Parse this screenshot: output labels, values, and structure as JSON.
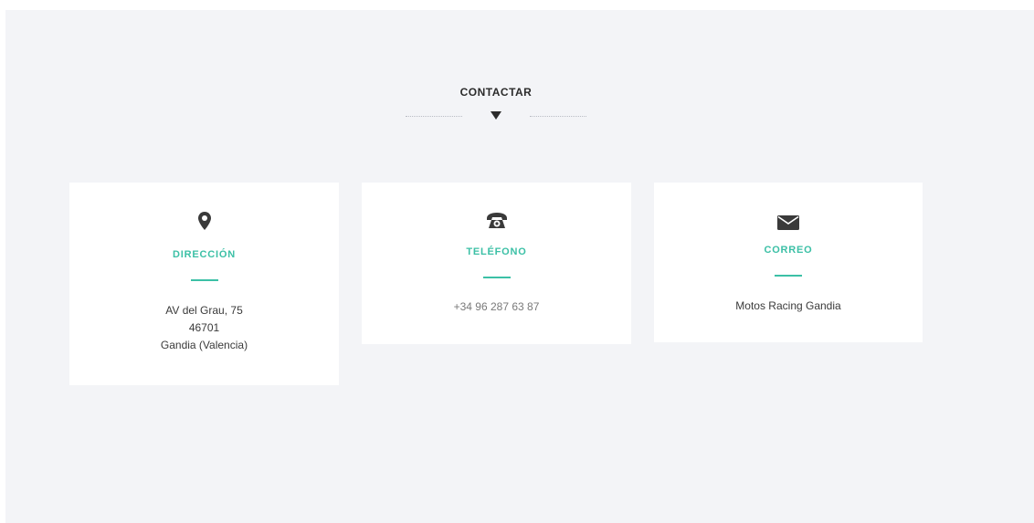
{
  "section": {
    "heading": "CONTACTAR"
  },
  "cards": [
    {
      "icon": "map-marker-icon",
      "title": "DIRECCIÓN",
      "lines": [
        "AV del Grau, 75",
        "46701",
        "Gandia (Valencia)"
      ]
    },
    {
      "icon": "telephone-icon",
      "title": "TELÉFONO",
      "lines": [
        "+34 96 287 63 87"
      ]
    },
    {
      "icon": "envelope-icon",
      "title": "CORREO",
      "lines": [
        "Motos Racing Gandia"
      ]
    }
  ],
  "colors": {
    "accent": "#3cc0a6",
    "background": "#f3f4f7",
    "card": "#ffffff",
    "icon": "#3a3a3a",
    "heading": "#2b2b2b"
  }
}
